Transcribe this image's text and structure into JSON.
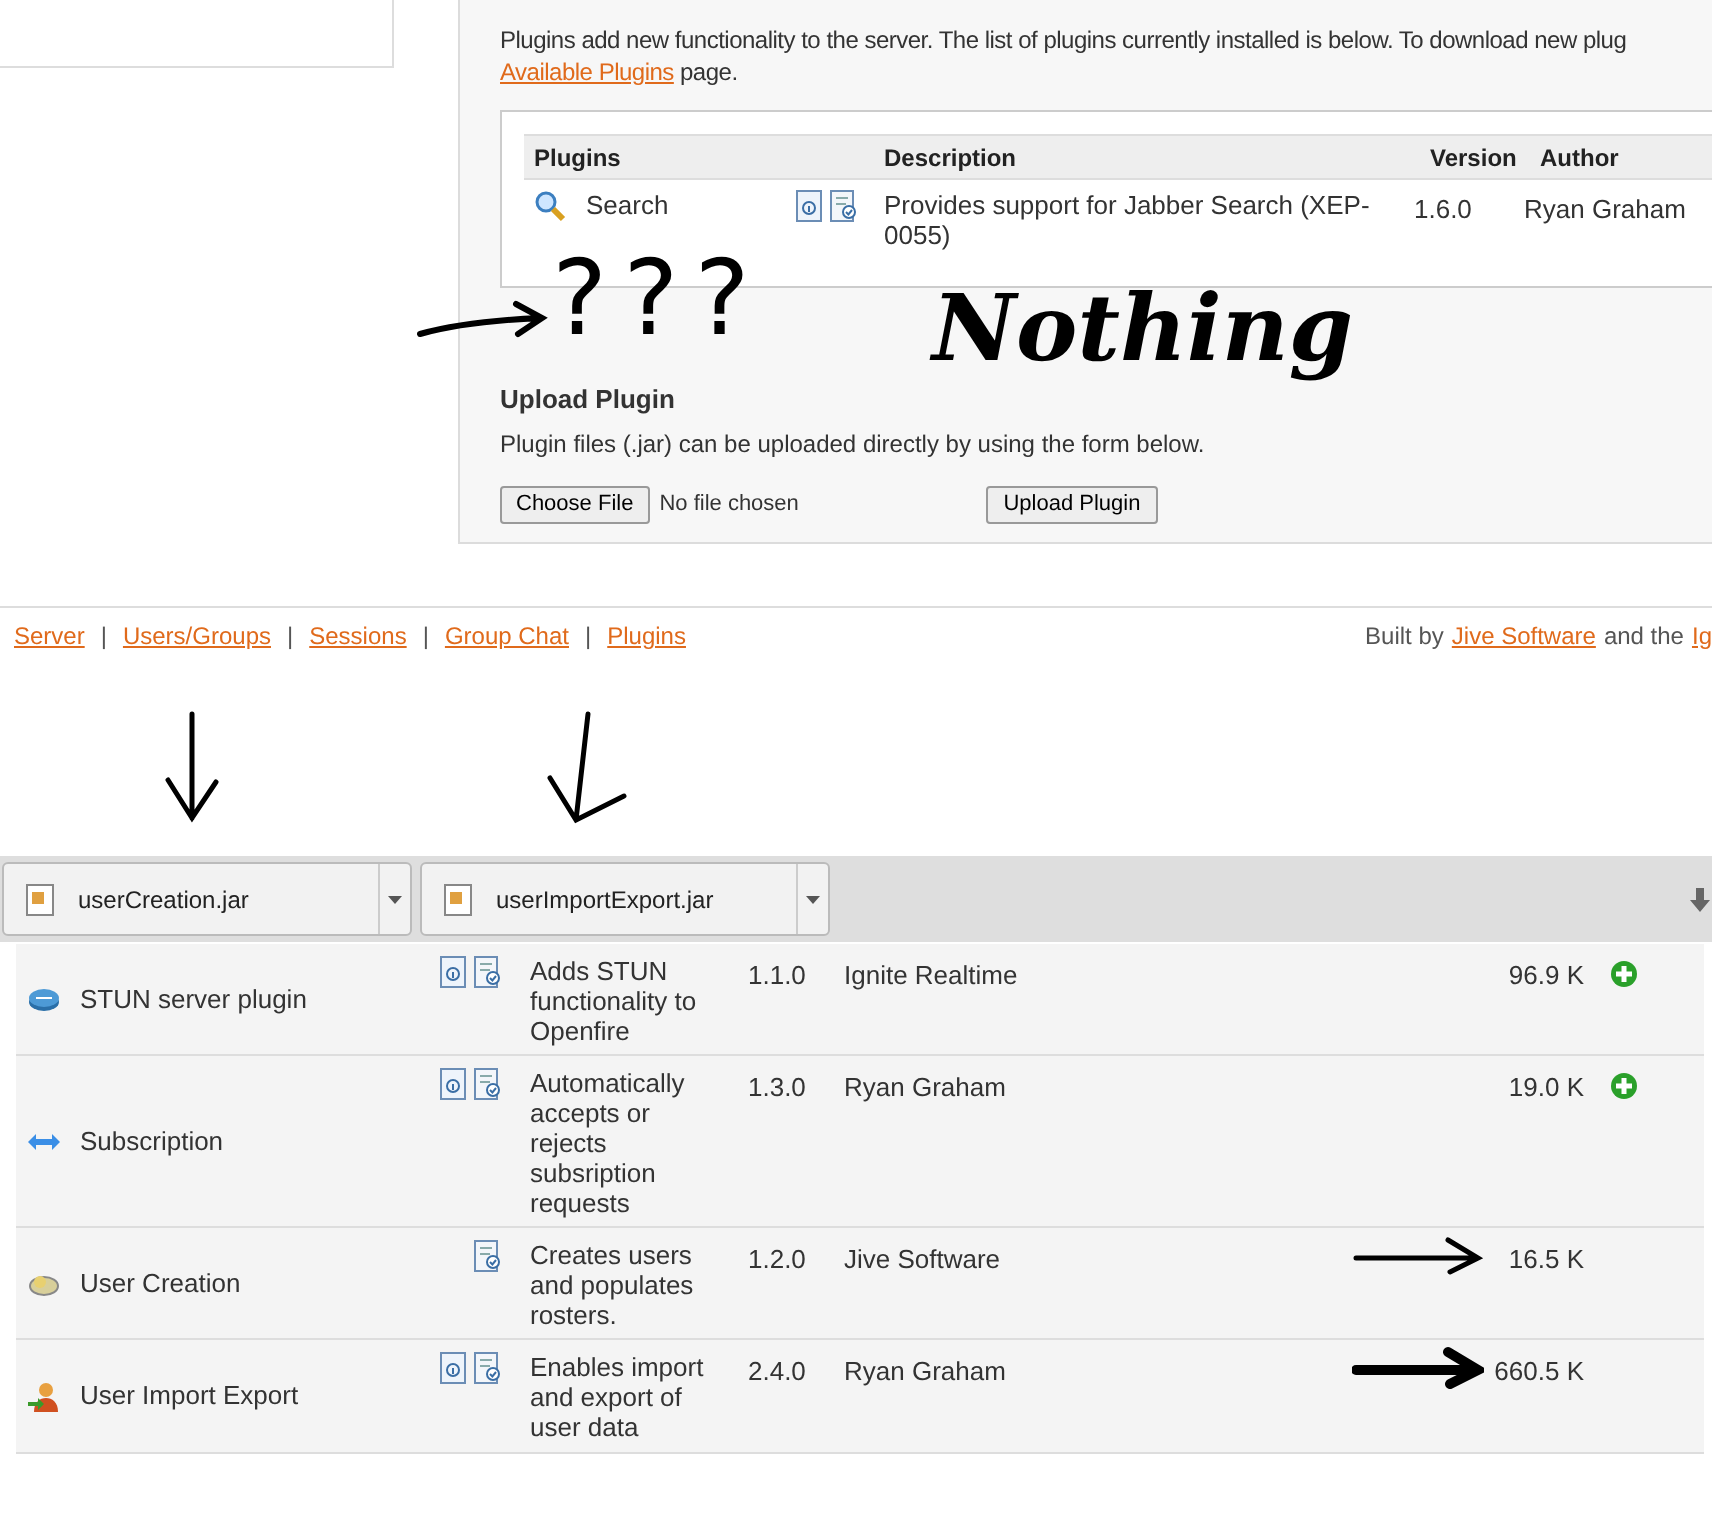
{
  "intro": {
    "text": "Plugins add new functionality to the server. The list of plugins currently installed is below. To download new plug",
    "link": "Available Plugins",
    "after": "page."
  },
  "installed_table": {
    "columns": [
      "Plugins",
      "Description",
      "Version",
      "Author"
    ],
    "rows": [
      {
        "name": "Search",
        "readme": true,
        "changelog": true,
        "description": "Provides support for Jabber Search (XEP-0055)",
        "version": "1.6.0",
        "author": "Ryan Graham"
      }
    ]
  },
  "annotations": {
    "question_marks": "???",
    "note": "Nothing"
  },
  "upload": {
    "title": "Upload Plugin",
    "description": "Plugin files (.jar) can be uploaded directly by using the form below.",
    "choose_button": "Choose File",
    "file_status": "No file chosen",
    "upload_button": "Upload Plugin"
  },
  "footer": {
    "links": [
      "Server",
      "Users/Groups",
      "Sessions",
      "Group Chat",
      "Plugins"
    ],
    "separator": "|",
    "credit_prefix": "Built by",
    "credit_link": "Jive Software",
    "credit_suffix": "and the",
    "credit_cut": "Ig"
  },
  "downloads": [
    {
      "filename": "userCreation.jar"
    },
    {
      "filename": "userImportExport.jar"
    }
  ],
  "available_plugins": [
    {
      "kind": "stun",
      "name": "STUN server plugin",
      "readme": true,
      "changelog": true,
      "description": "Adds STUN functionality to Openfire",
      "version": "1.1.0",
      "author": "Ignite Realtime",
      "size": "96.9 K",
      "installable": true,
      "arrow": false
    },
    {
      "kind": "subscription",
      "name": "Subscription",
      "readme": true,
      "changelog": true,
      "description": "Automatically accepts or rejects subsription requests",
      "version": "1.3.0",
      "author": "Ryan Graham",
      "size": "19.0 K",
      "installable": true,
      "arrow": false
    },
    {
      "kind": "user_creation",
      "name": "User Creation",
      "readme": false,
      "changelog": true,
      "description": "Creates users and populates rosters.",
      "version": "1.2.0",
      "author": "Jive Software",
      "size": "16.5 K",
      "installable": false,
      "arrow": true
    },
    {
      "kind": "user_import",
      "name": "User Import Export",
      "readme": true,
      "changelog": true,
      "description": "Enables import and export of user data",
      "version": "2.4.0",
      "author": "Ryan Graham",
      "size": "660.5 K",
      "installable": false,
      "arrow": true
    }
  ]
}
